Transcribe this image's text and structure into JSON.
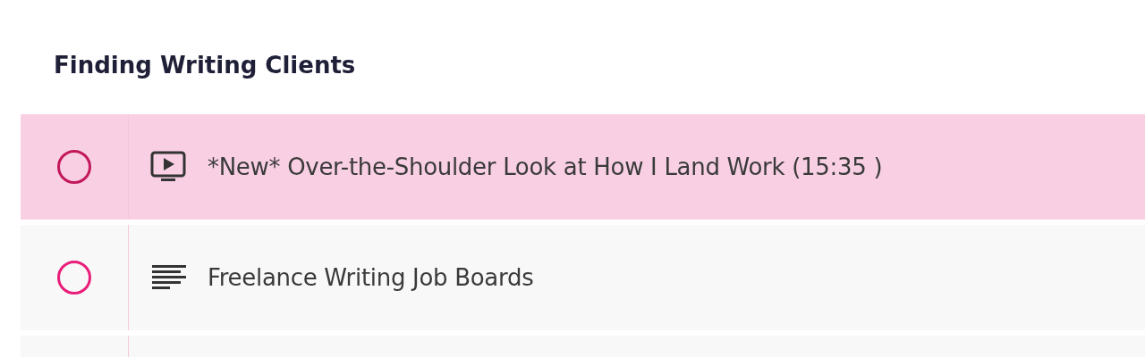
{
  "section": {
    "title": "Finding Writing Clients"
  },
  "lessons": [
    {
      "kind": "video",
      "title": "*New* Over-the-Shoulder Look at How I Land Work (15:35 )",
      "selected": true
    },
    {
      "kind": "text",
      "title": "Freelance Writing Job Boards",
      "selected": false
    }
  ]
}
